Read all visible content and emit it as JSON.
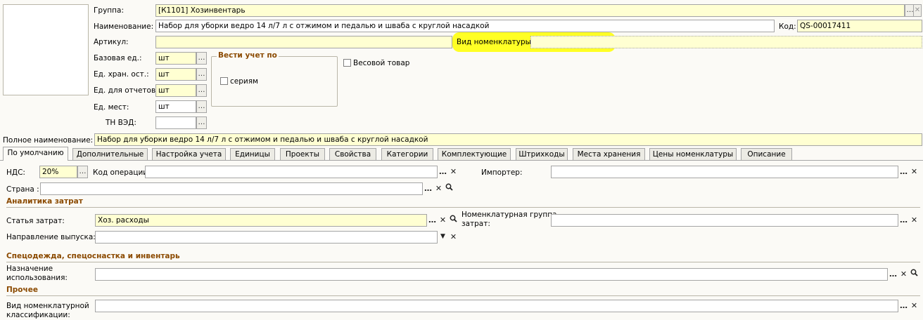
{
  "header": {
    "group_label": "Группа:",
    "group_value": "[К1101] Хозинвентарь",
    "name_label": "Наименование:",
    "name_value": "Набор для уборки ведро 14 л/7 л с отжимом и педалью и шваба с круглой насадкой",
    "code_label": "Код:",
    "code_value": "QS-00017411",
    "article_label": "Артикул:",
    "article_value": "",
    "nom_type_label": "Вид номенклатуры:",
    "nom_type_value": "",
    "base_unit_label": "Базовая ед.:",
    "base_unit_value": "шт",
    "storage_unit_label": "Ед. хран. ост.:",
    "storage_unit_value": "шт",
    "report_unit_label": "Ед. для отчетов:",
    "report_unit_value": "шт",
    "place_unit_label": "Ед. мест:",
    "place_unit_value": "шт",
    "tnved_label": "ТН ВЭД:",
    "tnved_value": "",
    "track_group_title": "Вести учет по",
    "series_label": "сериям",
    "weight_label": "Весовой товар",
    "full_name_label": "Полное наименование:",
    "full_name_value": "Набор для уборки ведро 14 л/7 л с отжимом и педалью и шваба с круглой насадкой"
  },
  "tabs": [
    "По умолчанию",
    "Дополнительные",
    "Настройка учета",
    "Единицы",
    "Проекты",
    "Свойства",
    "Категории",
    "Комплектующие",
    "Штрихкоды",
    "Места хранения",
    "Цены номенклатуры",
    "Описание"
  ],
  "main": {
    "vat_label": "НДС:",
    "vat_value": "20%",
    "op_code_label": "Код операции:",
    "op_code_value": "",
    "importer_label": "Импортер:",
    "importer_value": "",
    "country_label": "Страна :",
    "country_value": "",
    "cost_section": "Аналитика затрат",
    "cost_item_label": "Статья затрат:",
    "cost_item_value": "Хоз. расходы",
    "nom_group_label_1": "Номенклатурная группа",
    "nom_group_label_2": "затрат:",
    "nom_group_value": "",
    "release_dir_label": "Направление выпуска:",
    "release_dir_value": "",
    "workwear_section": "Спецодежда, спецоснастка и инвентарь",
    "purpose_label_1": "Назначение",
    "purpose_label_2": "использования:",
    "purpose_value": "",
    "other_section": "Прочее",
    "classif_label_1": "Вид номенклатурной",
    "classif_label_2": "классификации:",
    "classif_value": ""
  },
  "icons": {
    "select": "…",
    "clear": "✕",
    "search": "magnifier-icon",
    "dropdown": "▼"
  },
  "colors": {
    "required_field": "#ffffd2",
    "highlight": "#ffff00",
    "section_title": "#8b4a00"
  }
}
